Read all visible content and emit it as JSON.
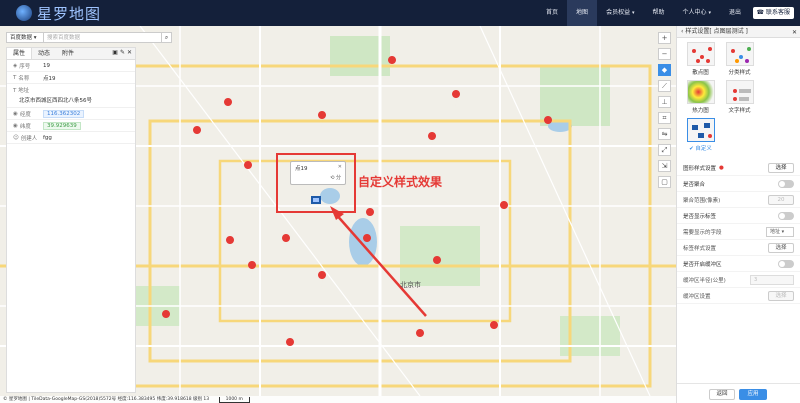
{
  "header": {
    "logo_text": "星罗地图",
    "nav": [
      {
        "label": "首页"
      },
      {
        "label": "地图"
      },
      {
        "label": "会员权益"
      },
      {
        "label": "帮助"
      },
      {
        "label": "个人中心"
      },
      {
        "label": "退出"
      }
    ],
    "contact_label": "联系客服",
    "active_nav": "地图"
  },
  "search": {
    "source_label": "百度数据",
    "placeholder": "搜索百度数据"
  },
  "attr_panel": {
    "tabs": [
      "属性",
      "动态",
      "附件"
    ],
    "rows": [
      {
        "key": "序号",
        "value": "19"
      },
      {
        "key": "名称",
        "value": "点19"
      }
    ],
    "address_key": "地址",
    "address_value": "北京市西城区西四北八条56号",
    "longitude_key": "经度",
    "longitude_value": "116.362302",
    "latitude_key": "纬度",
    "latitude_value": "39.929639",
    "creator_key": "创建人",
    "creator_value": "fgg"
  },
  "popup": {
    "title": "点19",
    "action": "⟲ 分"
  },
  "annotation": "自定义样式效果",
  "map_labels": {
    "city_center": "北京市"
  },
  "statusbar": {
    "text": "© 星罗地图 | TileData-GoogleMap-GS(2018)5572号   经度:116.383495   纬度:39.918618   级别 13",
    "scale": "1000 m"
  },
  "right_panel": {
    "title": "样式设置[ 点图层测试 ]",
    "styles": [
      {
        "label": "散点图"
      },
      {
        "label": "分类样式"
      },
      {
        "label": "热力图"
      },
      {
        "label": "文字样式"
      },
      {
        "label": "自定义",
        "selected": true
      }
    ],
    "rows": {
      "icon_style": "图形样式设置",
      "icon_btn": "选择",
      "aggregate": "是否聚合",
      "aggregate_range": "聚合范围(像素)",
      "aggregate_range_value": "20",
      "show_label": "是否显示标签",
      "label_field": "需要显示的字段",
      "label_field_value": "地址",
      "label_style": "标签样式设置",
      "label_style_btn": "选择",
      "buffer": "是否开启缓冲区",
      "buffer_radius": "缓冲区半径(公里)",
      "buffer_radius_value": "3",
      "buffer_style": "缓冲区设置",
      "buffer_style_btn": "选择"
    },
    "reset_label": "返回",
    "apply_label": "应用"
  },
  "colors": {
    "nav_bg": "#14203a",
    "accent": "#3a8ee6",
    "marker": "#e53935",
    "annotation": "#e53935"
  }
}
